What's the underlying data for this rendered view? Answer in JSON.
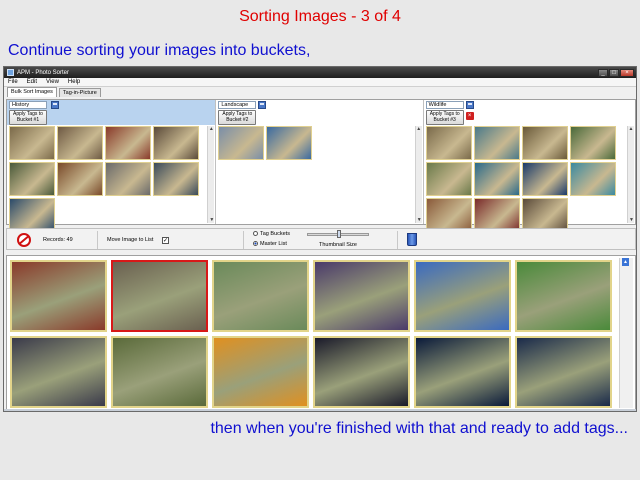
{
  "slide": {
    "title": "Sorting Images  -  3 of 4",
    "caption_top": "Continue sorting your images into buckets,",
    "caption_bottom": "then when you're finished with that and ready to add tags..."
  },
  "window": {
    "title": "APM - Photo Sorter",
    "minimize": "_",
    "maximize": "□",
    "close": "×"
  },
  "menu": [
    "File",
    "Edit",
    "View",
    "Help"
  ],
  "tabs": [
    "Bulk Sort Images",
    "Tag-in-Picture"
  ],
  "buckets": [
    {
      "name": "History",
      "apply_label": "Apply Tags to Bucket #1",
      "thumbs": [
        "#7b6a4a",
        "#6e5a44",
        "#8a3a2a",
        "#5a4a3a",
        "#4a5a3a",
        "#7a4a2a",
        "#6a6a6a",
        "#3a4a5a",
        "#2a4a6a"
      ]
    },
    {
      "name": "Landscape",
      "apply_label": "Apply Tags to Bucket #2",
      "thumbs": [
        "#7a8ea8",
        "#3a6aa0"
      ]
    },
    {
      "name": "Wildlife",
      "apply_label": "Apply Tags to Bucket #3",
      "thumbs": [
        "#7a6a4a",
        "#4a7a8a",
        "#6a5a3a",
        "#4a6a3a",
        "#6a7a4a",
        "#2a6a8a",
        "#1a3a6a",
        "#3a8aa0",
        "#8a5a3a",
        "#7a2a2a",
        "#5a4a3a"
      ]
    }
  ],
  "middle": {
    "records": "Records: 49",
    "move_label": "Move Image to List",
    "move_checked": "✓",
    "tag_buckets": "Tag Buckets",
    "master_list": "Master List",
    "thumb_size": "Thumbnail Size"
  },
  "master": {
    "thumbs": [
      "#8a3a2a",
      "#6a6050",
      "#6a8a5a",
      "#4a3a6a",
      "#3a6ac0",
      "#4a8a3a",
      "#3a3a4a",
      "#5a6a3a",
      "#e09020",
      "#1a1a2a",
      "#0a1a3a",
      "#1a2a4a"
    ],
    "selected_index": 1
  },
  "colors": {
    "title_red": "#e00000",
    "caption_blue": "#1010d0",
    "history_header": "#b9d3ef"
  }
}
